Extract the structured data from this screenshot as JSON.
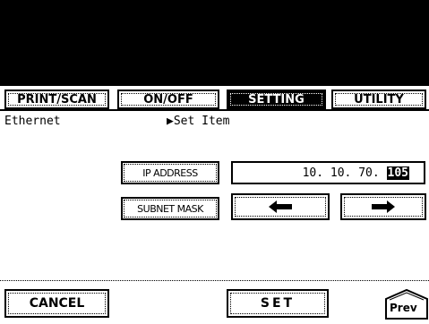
{
  "tabs": [
    {
      "label": "PRINT/SCAN"
    },
    {
      "label": "ON/OFF"
    },
    {
      "label": "SETTING"
    },
    {
      "label": "UTILITY"
    }
  ],
  "breadcrumb": {
    "section": "Ethernet",
    "item": "▶Set Item"
  },
  "buttons": {
    "ip_address": "IP ADDRESS",
    "subnet_mask": "SUBNET MASK",
    "cancel": "CANCEL",
    "set": "SET",
    "prev": "Prev"
  },
  "ip_field": {
    "octet1": "10.",
    "octet2": "10.",
    "octet3": "70.",
    "octet4": "105"
  },
  "icons": {
    "left": "arrow-left-icon",
    "right": "arrow-right-icon"
  }
}
